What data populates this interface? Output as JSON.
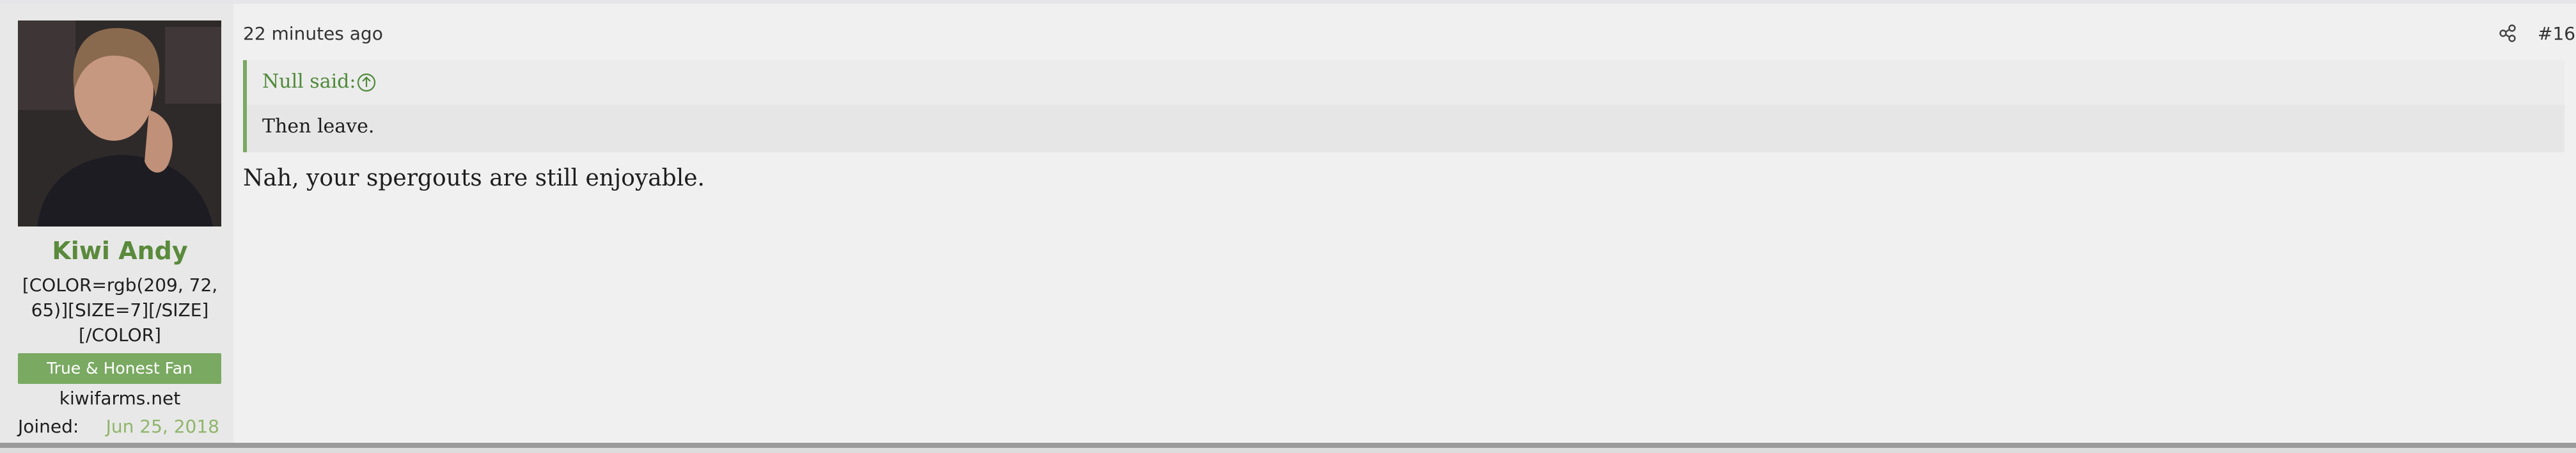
{
  "post": {
    "timestamp": "22 minutes ago",
    "number": "#16",
    "share_icon": "share-icon",
    "quote": {
      "author": "Null said:",
      "expand_icon": "arrow-up-circle-icon",
      "text": "Then leave."
    },
    "body": "Nah, your spergouts are still enjoyable."
  },
  "user": {
    "name": "Kiwi Andy",
    "title": "[COLOR=rgb(209, 72, 65)][SIZE=7][/SIZE][/COLOR]",
    "banner": "True & Honest Fan",
    "site": "kiwifarms.net",
    "joined_label": "Joined:",
    "joined_value": "Jun 25, 2018"
  },
  "colors": {
    "accent": "#7aa962",
    "username": "#5a8a3c"
  }
}
